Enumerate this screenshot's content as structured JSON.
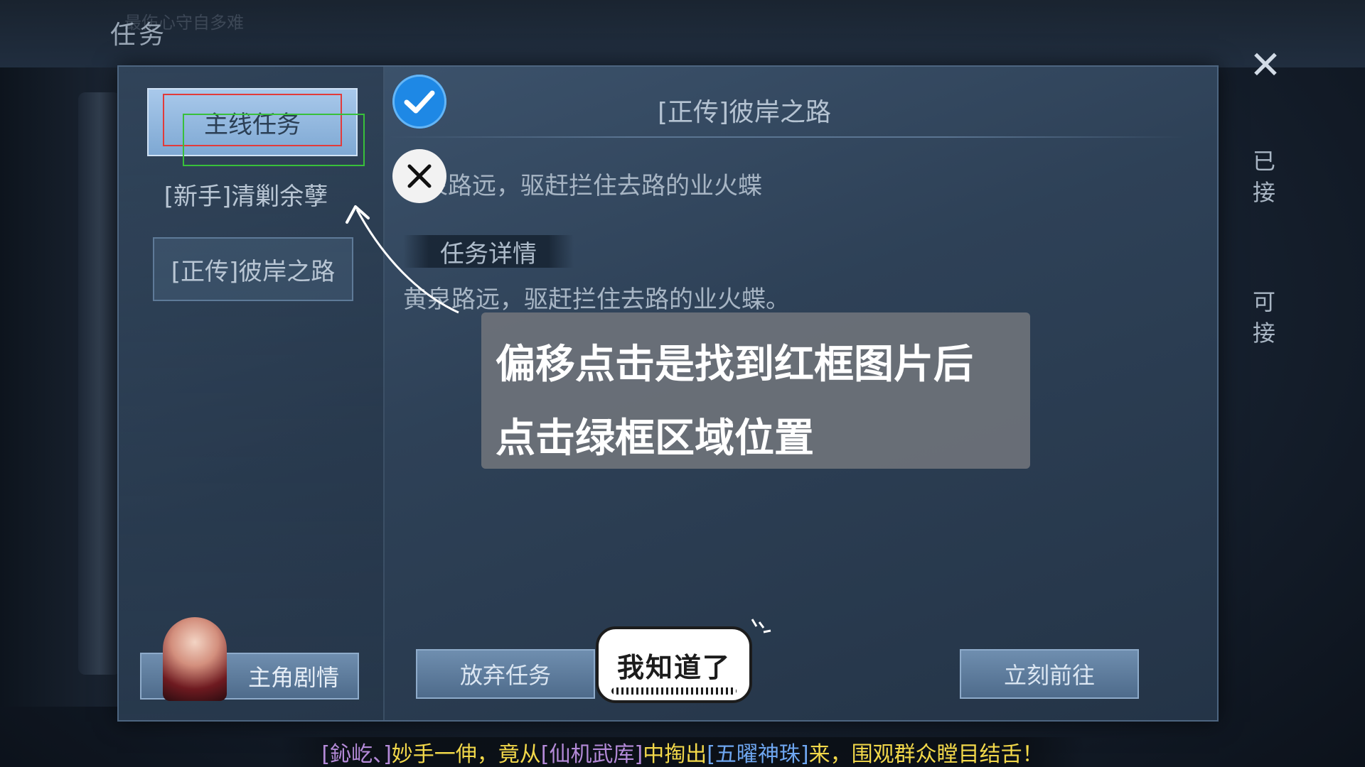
{
  "window": {
    "title": "任务"
  },
  "background": {
    "blurred_text": "最伤心守自多难"
  },
  "left_tabs": {
    "main_quest": "主线任务",
    "newbie_quest": "[新手]清剿余孽",
    "zhengzhuan_quest": "[正传]彼岸之路"
  },
  "content": {
    "quest_title": "[正传]彼岸之路",
    "quest_summary": "黄泉路远，驱赶拦住去路的业火蝶",
    "details_tab": "任务详情",
    "quest_description": "黄泉路远，驱赶拦住去路的业火蝶。"
  },
  "buttons": {
    "story": "主角剧情",
    "abandon": "放弃任务",
    "goto": "立刻前往",
    "close": "✕"
  },
  "side": {
    "accepted": "已接",
    "available": "可接"
  },
  "overlay": {
    "hint_line1": "偏移点击是找到红框图片后",
    "hint_line2": "点击绿框区域位置",
    "got_it": "我知道了"
  },
  "ticker": {
    "player": "[鈊屹、]",
    "text1": "妙手一伸，竟从",
    "item1": "[仙机武库]",
    "text2": "中掏出",
    "item2": "[五曜神珠]",
    "text3": "来，围观群众瞠目结舌！"
  },
  "colors": {
    "red_box": "#e23a3a",
    "green_box": "#38c03a",
    "check_blue": "#1e88e5"
  }
}
